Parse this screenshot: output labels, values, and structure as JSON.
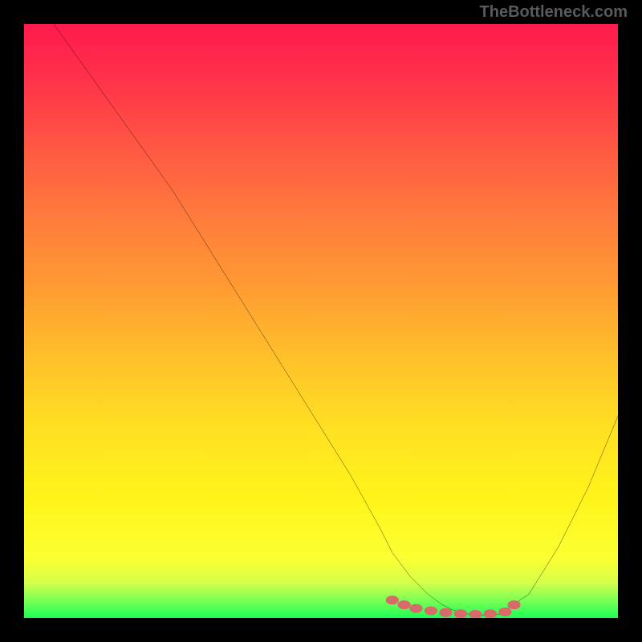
{
  "watermark": "TheBottleneck.com",
  "chart_data": {
    "type": "line",
    "title": "",
    "xlabel": "",
    "ylabel": "",
    "xlim": [
      0,
      100
    ],
    "ylim": [
      0,
      100
    ],
    "grid": false,
    "series": [
      {
        "name": "curve",
        "x": [
          5,
          10,
          15,
          20,
          25,
          30,
          35,
          40,
          45,
          50,
          55,
          60,
          62,
          65,
          68,
          70,
          72,
          75,
          78,
          80,
          85,
          90,
          95,
          100
        ],
        "y": [
          100,
          93,
          86,
          79,
          72,
          64,
          56,
          48,
          40,
          32,
          24,
          15,
          11,
          7,
          4,
          2.5,
          1.4,
          0.6,
          0.4,
          0.6,
          4,
          12,
          22,
          34
        ],
        "color": "#000000",
        "linewidth": 2
      }
    ],
    "markers": {
      "name": "emphasis-dots",
      "color": "#d96a6a",
      "x": [
        62,
        64,
        66,
        68.5,
        71,
        73.5,
        76,
        78.5,
        81,
        82.5
      ],
      "y": [
        3.0,
        2.2,
        1.6,
        1.2,
        0.9,
        0.7,
        0.6,
        0.7,
        1.0,
        2.2
      ]
    },
    "background_gradient": {
      "stops": [
        {
          "offset": 0,
          "color": "#ff1a4d"
        },
        {
          "offset": 8,
          "color": "#ff2e4a"
        },
        {
          "offset": 20,
          "color": "#ff5544"
        },
        {
          "offset": 32,
          "color": "#ff7a3c"
        },
        {
          "offset": 44,
          "color": "#ff9a33"
        },
        {
          "offset": 56,
          "color": "#ffc02a"
        },
        {
          "offset": 68,
          "color": "#ffe022"
        },
        {
          "offset": 80,
          "color": "#fff41a"
        },
        {
          "offset": 90,
          "color": "#fcff33"
        },
        {
          "offset": 94,
          "color": "#d6ff4a"
        },
        {
          "offset": 97,
          "color": "#7cff55"
        },
        {
          "offset": 100,
          "color": "#1aff55"
        }
      ]
    }
  }
}
